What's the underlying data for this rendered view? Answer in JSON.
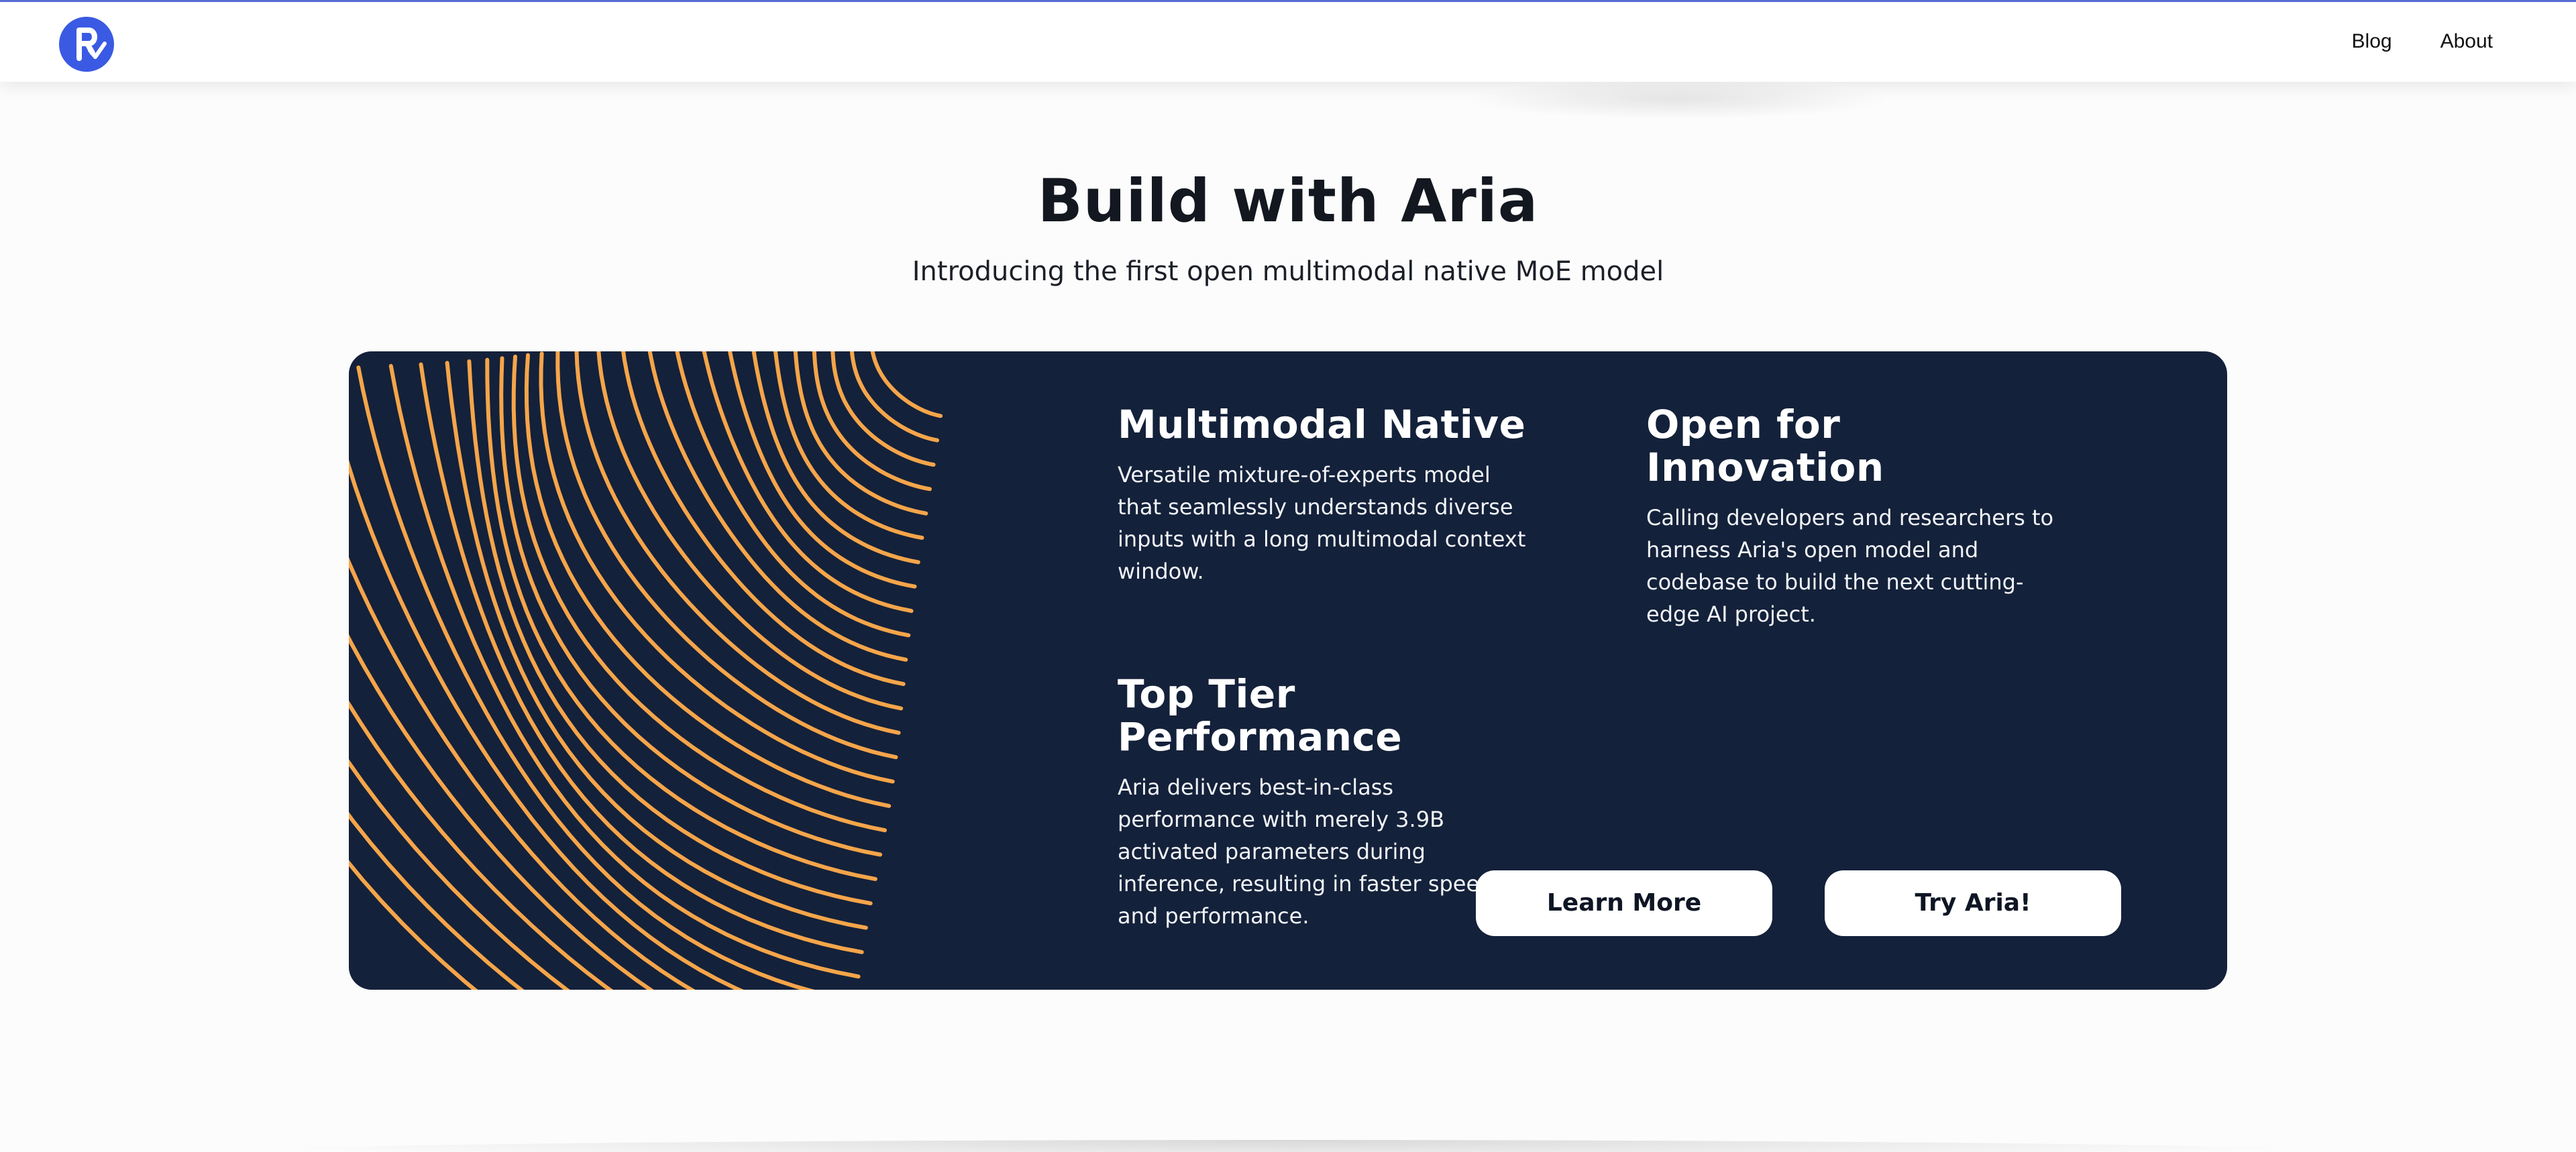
{
  "header": {
    "logo_icon": "rhymes-logo-icon",
    "nav": [
      {
        "label": "Blog"
      },
      {
        "label": "About"
      }
    ]
  },
  "hero": {
    "title": "Build with Aria",
    "subtitle": "Introducing the first open multimodal native MoE model"
  },
  "card": {
    "features": [
      {
        "title": "Multimodal Native",
        "body": "Versatile mixture-of-experts model that seamlessly understands diverse inputs with a long multimodal context window."
      },
      {
        "title": "Open for Innovation",
        "body": "Calling developers and researchers to harness Aria's open model and codebase to build the next cutting-edge AI project."
      },
      {
        "title": "Top Tier Performance",
        "body": "Aria delivers best-in-class performance with merely 3.9B activated parameters during inference, resulting in faster speeds and performance."
      }
    ],
    "buttons": {
      "learn_more": "Learn More",
      "try_aria": "Try Aria!"
    }
  },
  "colors": {
    "brand": "#3a5ae3",
    "card_bg": "#14213a",
    "line_art": "#f5a54a"
  }
}
